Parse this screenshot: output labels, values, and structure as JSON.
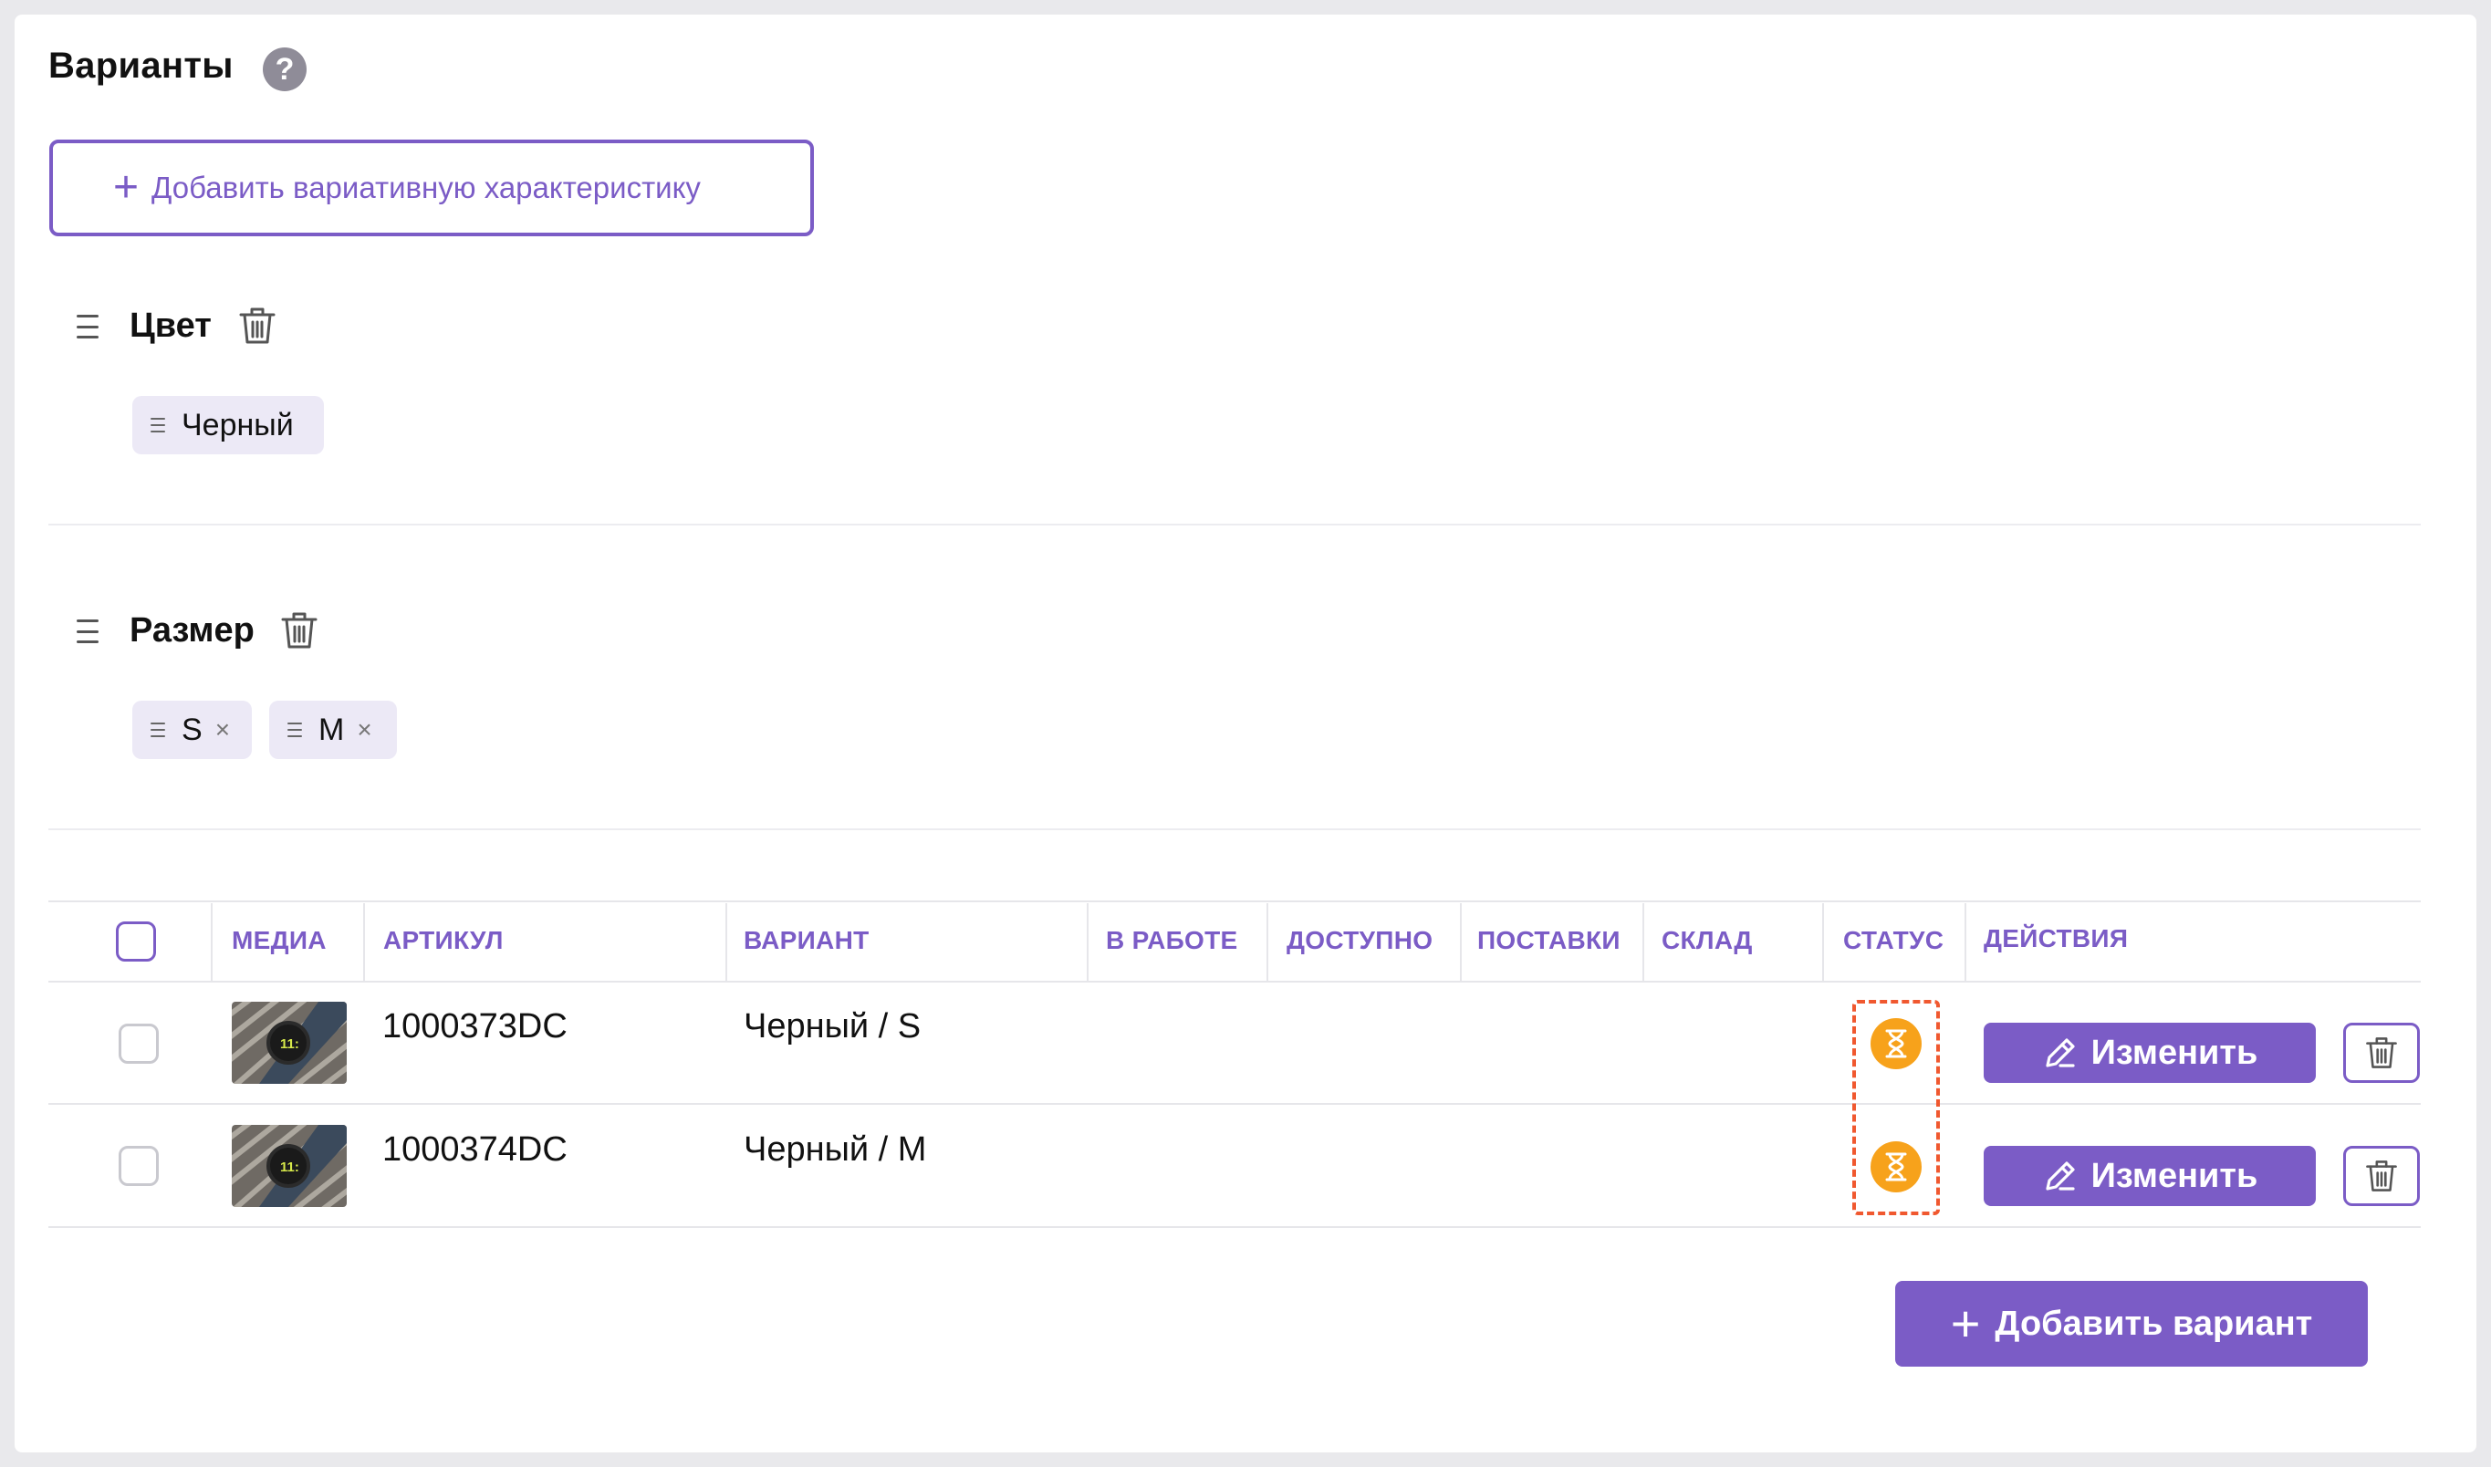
{
  "section": {
    "title": "Варианты",
    "help_glyph": "?",
    "add_characteristic_label": "Добавить вариативную характеристику",
    "add_characteristic_icon": "+"
  },
  "groups": [
    {
      "label": "Цвет",
      "values": [
        {
          "label": "Черный",
          "removable": false
        }
      ]
    },
    {
      "label": "Размер",
      "values": [
        {
          "label": "S",
          "removable": true
        },
        {
          "label": "M",
          "removable": true
        }
      ]
    }
  ],
  "table": {
    "columns": [
      "МЕДИА",
      "АРТИКУЛ",
      "ВАРИАНТ",
      "В РАБОТЕ",
      "ДОСТУПНО",
      "ПОСТАВКИ",
      "СКЛАД",
      "СТАТУС",
      "ДЕЙСТВИЯ"
    ],
    "rows": [
      {
        "sku": "1000373DC",
        "variant": "Черный / S",
        "status": "hourglass-pending",
        "edit_label": "Изменить"
      },
      {
        "sku": "1000374DC",
        "variant": "Черный / M",
        "status": "hourglass-pending",
        "edit_label": "Изменить"
      }
    ]
  },
  "add_variant_label": "Добавить вариант",
  "add_variant_icon": "+",
  "remove_glyph": "×",
  "colors": {
    "accent": "#7b5cc6",
    "status_pending": "#f7a21b",
    "highlight": "#f0582f"
  }
}
